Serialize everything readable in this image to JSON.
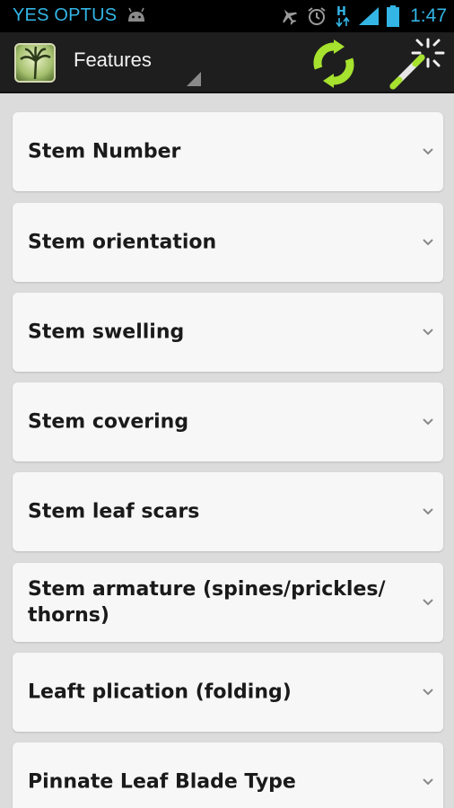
{
  "status_bar": {
    "carrier": "YES OPTUS",
    "network_indicator": "H",
    "time": "1:47"
  },
  "action_bar": {
    "title": "Features",
    "icons": [
      "app-palm-icon",
      "refresh-icon",
      "magic-wand-icon"
    ]
  },
  "features": [
    {
      "label": "Stem Number"
    },
    {
      "label": "Stem orientation"
    },
    {
      "label": "Stem swelling"
    },
    {
      "label": "Stem covering"
    },
    {
      "label": "Stem leaf scars"
    },
    {
      "label": "Stem armature (spines/prickles/ thorns)"
    },
    {
      "label": "Leaft plication (folding)"
    },
    {
      "label": "Pinnate Leaf Blade Type"
    }
  ],
  "colors": {
    "accent_blue": "#33b5e5",
    "refresh_green": "#a6e22e",
    "background": "#dcdcdc"
  }
}
